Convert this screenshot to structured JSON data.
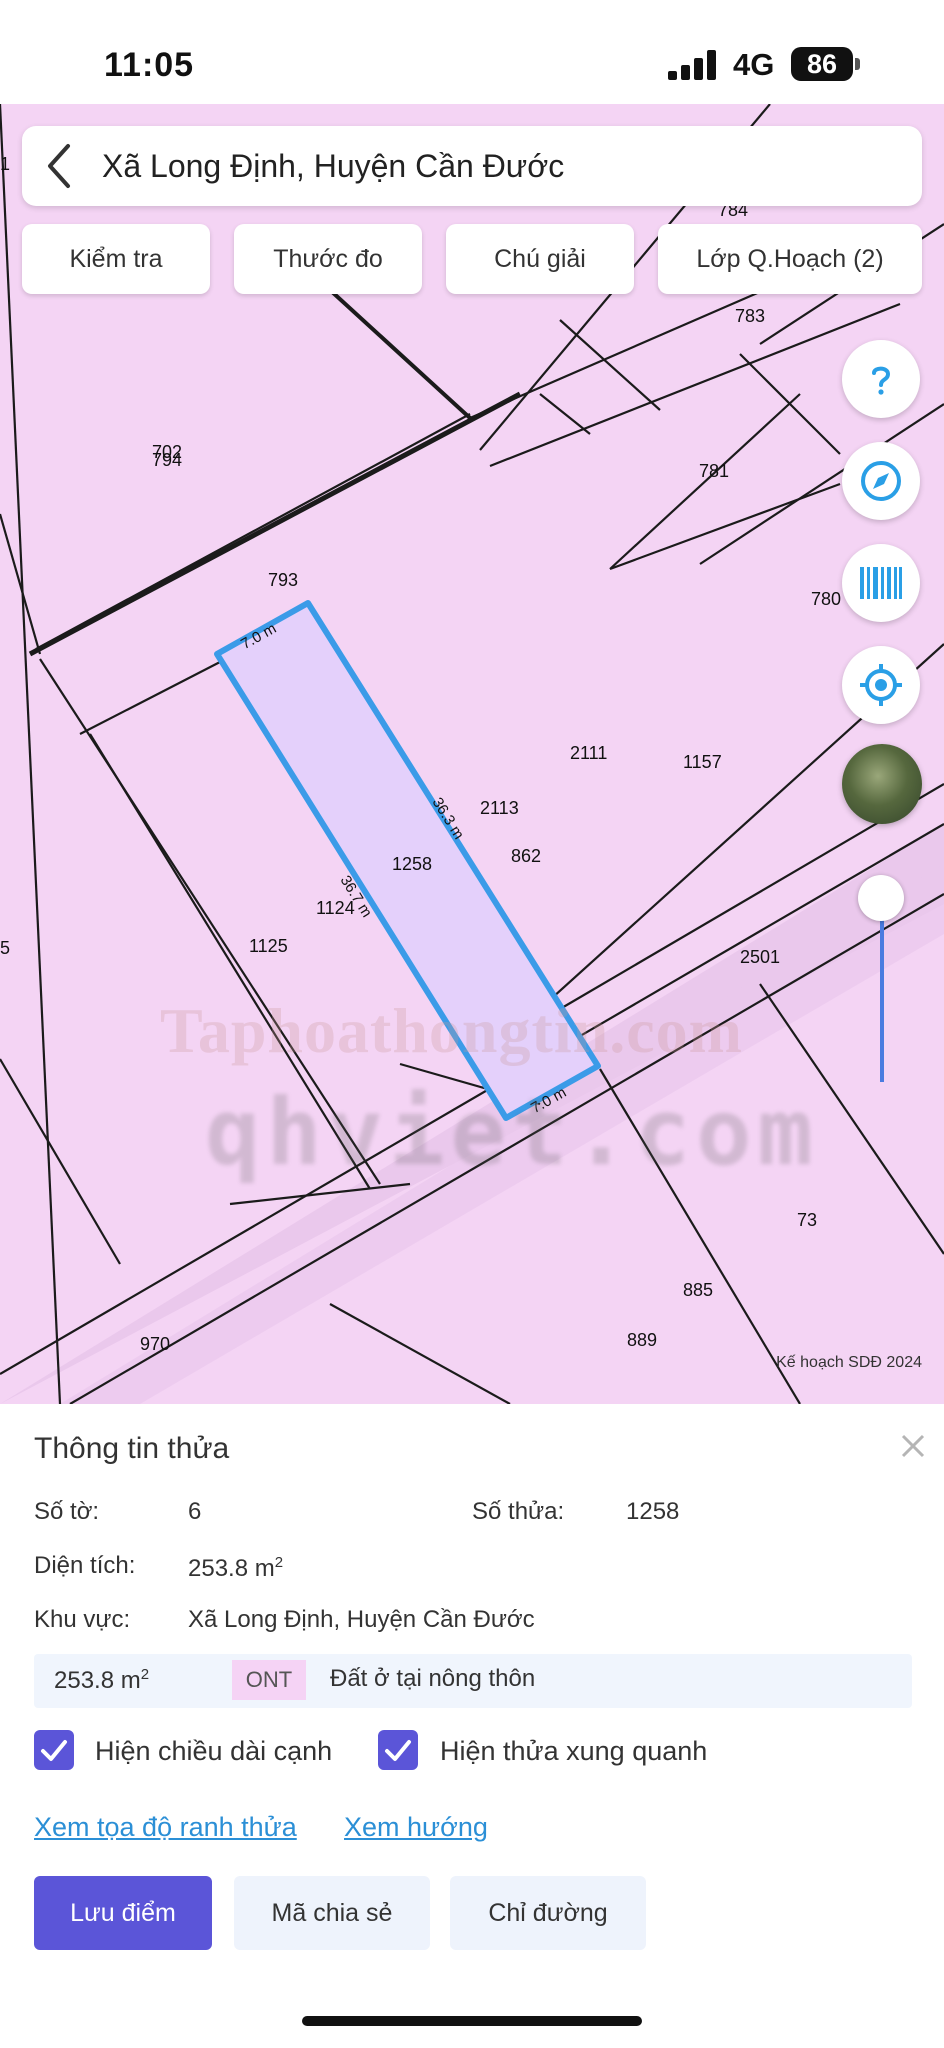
{
  "status_bar": {
    "time": "11:05",
    "network": "4G",
    "battery": "86"
  },
  "search": {
    "title": "Xã Long Định, Huyện Cần Đước"
  },
  "toolbar": {
    "check_label": "Kiểm tra",
    "measure_label": "Thước đo",
    "legend_label": "Chú giải",
    "layers_label": "Lớp Q.Hoạch (2)"
  },
  "map_controls": {
    "help_icon": "question-icon",
    "compass_icon": "compass-icon",
    "barcode_icon": "barcode-icon",
    "locate_icon": "locate-icon",
    "zoom_level": 0.92
  },
  "map": {
    "parcels": [
      "702",
      "794",
      "793",
      "784",
      "783",
      "781",
      "780",
      "2111",
      "1157",
      "2113",
      "862",
      "1258",
      "1124",
      "1125",
      "2501",
      "73",
      "885",
      "889",
      "970",
      "1",
      "5"
    ],
    "edges": {
      "top": "7.0 m",
      "right": "36.3 m",
      "left": "36.7 m",
      "bottom": "7.0 m"
    },
    "watermark_1": "Taphoathongtin.com",
    "watermark_2": "qhviet.com",
    "credit": "Kế hoạch SDĐ 2024",
    "colors": {
      "land": "#f4d4f4",
      "selected_fill": "#e4d0fb",
      "selected_stroke": "#3b9be8"
    }
  },
  "parcel_info": {
    "title": "Thông tin thửa",
    "sheet_label": "Số tờ:",
    "sheet_value": "6",
    "plot_label": "Số thửa:",
    "plot_value": "1258",
    "area_label": "Diện tích:",
    "area_value": "253.8 m",
    "area_unit_sup": "2",
    "region_label": "Khu vực:",
    "region_value": "Xã Long Định, Huyện Cần Đước",
    "land_use": {
      "area": "253.8 m",
      "area_sup": "2",
      "code": "ONT",
      "name": "Đất ở tại nông thôn"
    },
    "show_edge_length": "Hiện chiều dài cạnh",
    "show_neighbors": "Hiện thửa xung quanh",
    "view_coordinates": "Xem tọa độ ranh thửa",
    "view_direction": "Xem hướng",
    "save_point": "Lưu điểm",
    "share_code": "Mã chia sẻ",
    "directions": "Chỉ đường"
  }
}
